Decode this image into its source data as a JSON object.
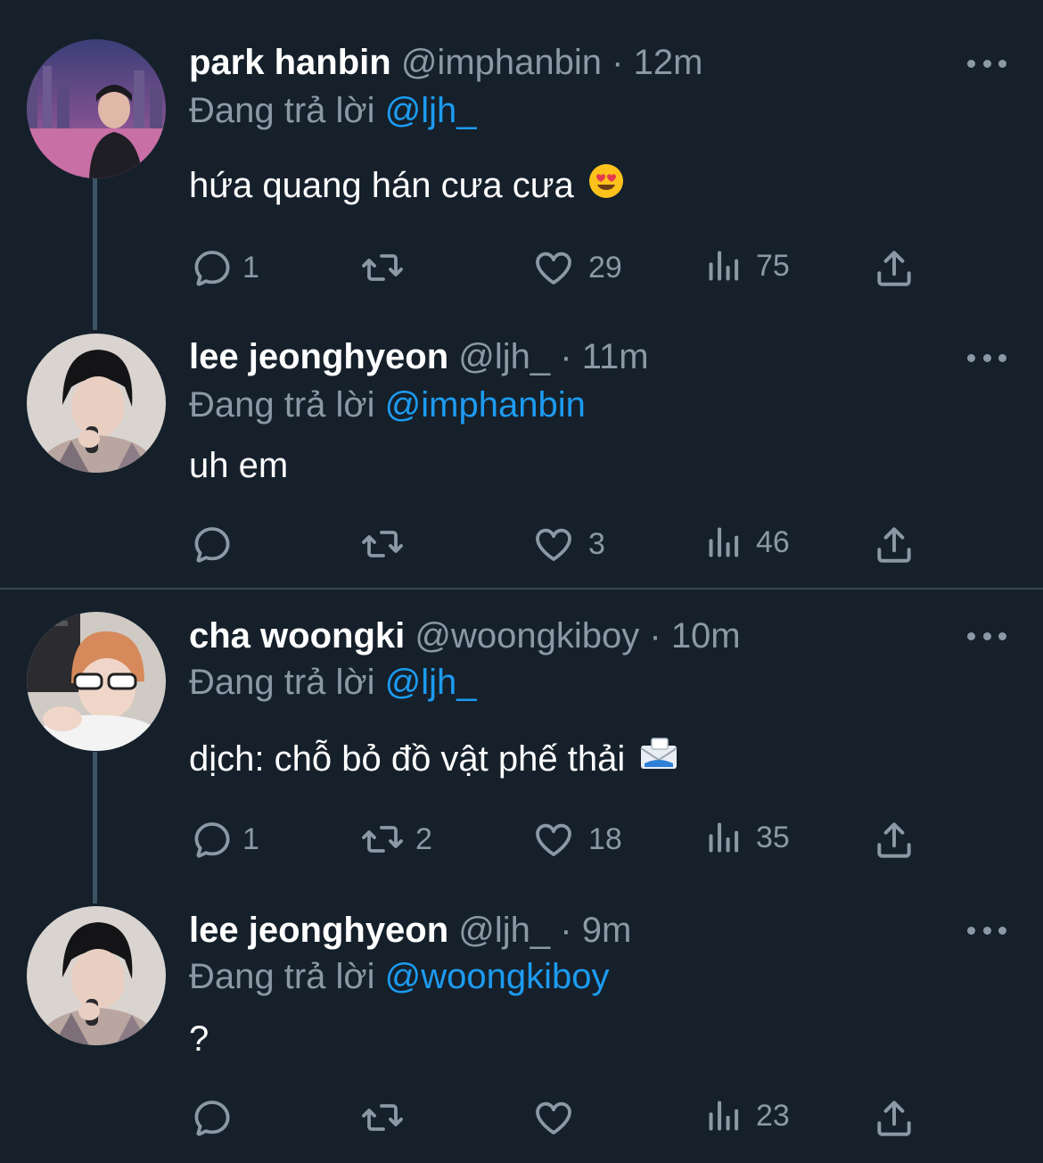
{
  "tweets": [
    {
      "name": "park hanbin",
      "handle": "@imphanbin",
      "dot": "·",
      "time": "12m",
      "reply_prefix": "Đang trả lời",
      "reply_to": "@ljh_",
      "text": "hứa quang hán cưa cưa",
      "emoji": "heart-eyes-emoji",
      "replies": "1",
      "retweets": "",
      "likes": "29",
      "views": "75"
    },
    {
      "name": "lee jeonghyeon",
      "handle": "@ljh_",
      "dot": "·",
      "time": "11m",
      "reply_prefix": "Đang trả lời",
      "reply_to": "@imphanbin",
      "text": "uh em",
      "replies": "",
      "retweets": "",
      "likes": "3",
      "views": "46"
    },
    {
      "name": "cha woongki",
      "handle": "@woongkiboy",
      "dot": "·",
      "time": "10m",
      "reply_prefix": "Đang trả lời",
      "reply_to": "@ljh_",
      "text": "dịch: chỗ bỏ đồ vật phế thải",
      "emoji": "envelope-emoji",
      "replies": "1",
      "retweets": "2",
      "likes": "18",
      "views": "35"
    },
    {
      "name": "lee jeonghyeon",
      "handle": "@ljh_",
      "dot": "·",
      "time": "9m",
      "reply_prefix": "Đang trả lời",
      "reply_to": "@woongkiboy",
      "text": "?",
      "replies": "",
      "retweets": "",
      "likes": "",
      "views": "23"
    }
  ],
  "colors": {
    "background": "#15202b",
    "muted": "#8b98a5",
    "accent": "#1d9bf0",
    "thread_line": "#3d5466"
  },
  "icons": [
    "reply-icon",
    "retweet-icon",
    "like-icon",
    "views-icon",
    "share-icon",
    "more-icon"
  ]
}
